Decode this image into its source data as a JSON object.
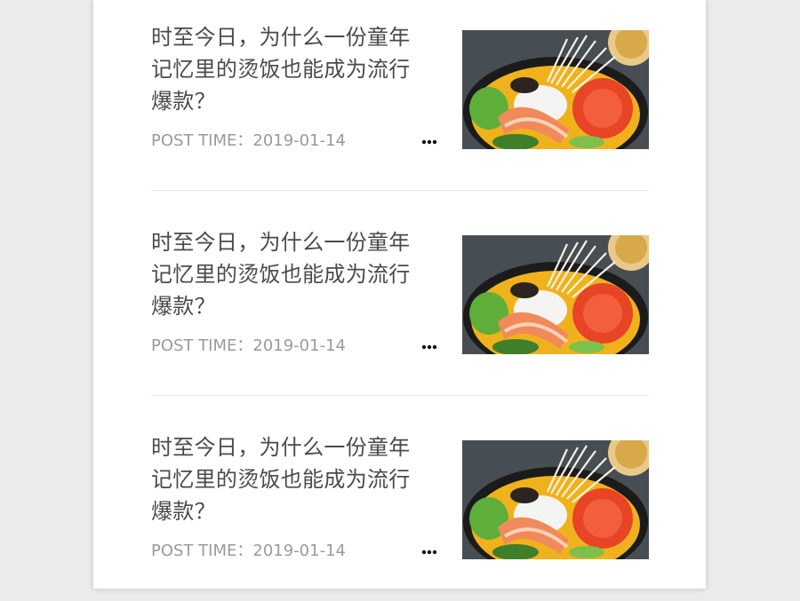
{
  "articles": [
    {
      "title": "时至今日，为什么一份童年\n记忆里的烫饭也能成为流行\n爆款？",
      "meta": "POST TIME：2019-01-14"
    },
    {
      "title": "时至今日，为什么一份童年\n记忆里的烫饭也能成为流行\n爆款？",
      "meta": "POST TIME：2019-01-14"
    },
    {
      "title": "时至今日，为什么一份童年\n记忆里的烫饭也能成为流行\n爆款？",
      "meta": "POST TIME：2019-01-14"
    }
  ],
  "icons": {
    "more": "more-horizontal-icon"
  }
}
